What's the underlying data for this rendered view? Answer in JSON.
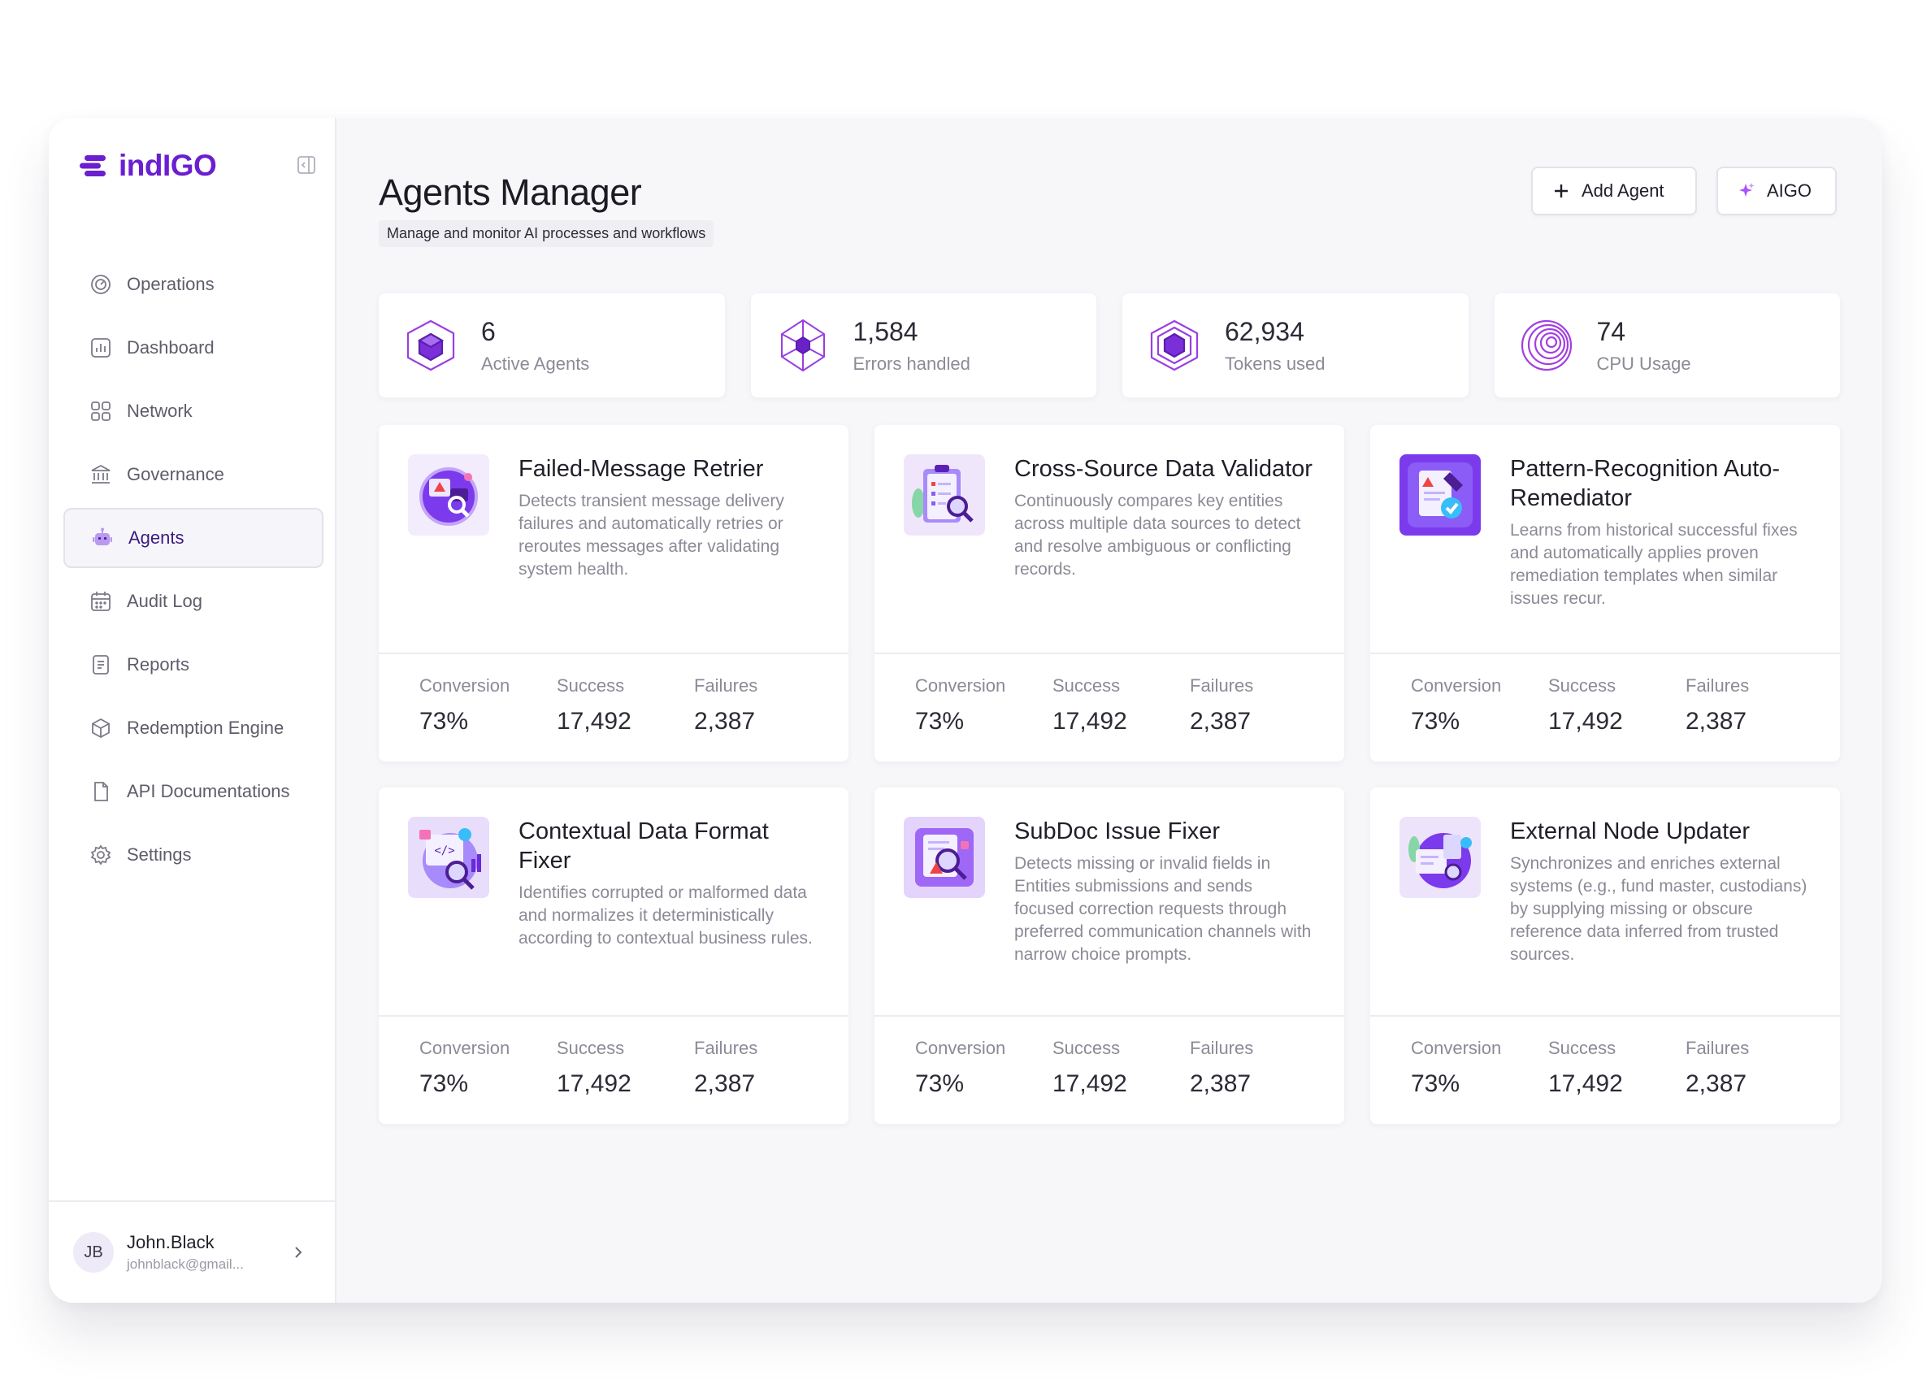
{
  "brand": {
    "name": "indIGO"
  },
  "colors": {
    "accent": "#6b1fd0",
    "accent_light": "#a855f7"
  },
  "sidebar": {
    "items": [
      {
        "label": "Operations",
        "icon": "gauge-icon",
        "active": false
      },
      {
        "label": "Dashboard",
        "icon": "bar-chart-icon",
        "active": false
      },
      {
        "label": "Network",
        "icon": "grid-icon",
        "active": false
      },
      {
        "label": "Governance",
        "icon": "bank-icon",
        "active": false
      },
      {
        "label": "Agents",
        "icon": "robot-icon",
        "active": true
      },
      {
        "label": "Audit Log",
        "icon": "calendar-icon",
        "active": false
      },
      {
        "label": "Reports",
        "icon": "document-list-icon",
        "active": false
      },
      {
        "label": "Redemption Engine",
        "icon": "cube-icon",
        "active": false
      },
      {
        "label": "API Documentations",
        "icon": "file-icon",
        "active": false
      },
      {
        "label": "Settings",
        "icon": "gear-icon",
        "active": false
      }
    ]
  },
  "user": {
    "initials": "JB",
    "name": "John.Black",
    "email": "johnblack@gmail..."
  },
  "header": {
    "title": "Agents Manager",
    "subtitle": "Manage and monitor AI processes and workflows",
    "add_agent_label": "Add Agent",
    "aigo_label": "AIGO"
  },
  "stats": [
    {
      "value": "6",
      "label": "Active Agents",
      "icon": "cube-3d-icon"
    },
    {
      "value": "1,584",
      "label": "Errors handled",
      "icon": "diamond-icon"
    },
    {
      "value": "62,934",
      "label": "Tokens used",
      "icon": "layers-hex-icon"
    },
    {
      "value": "74",
      "label": "CPU Usage",
      "icon": "spiral-icon"
    }
  ],
  "metric_labels": {
    "conversion": "Conversion",
    "success": "Success",
    "failures": "Failures"
  },
  "agents": [
    {
      "title": "Failed-Message Retrier",
      "desc": "Detects transient message delivery failures and automatically retries or reroutes messages after validating system health.",
      "conversion": "73%",
      "success": "17,492",
      "failures": "2,387",
      "icon": "retry-globe-icon"
    },
    {
      "title": "Cross-Source Data Validator",
      "desc": "Continuously compares key entities across multiple data sources to detect and resolve ambiguous or conflicting records.",
      "conversion": "73%",
      "success": "17,492",
      "failures": "2,387",
      "icon": "clipboard-check-icon"
    },
    {
      "title": "Pattern-Recognition Auto-Remediator",
      "desc": "Learns from historical successful fixes and automatically applies proven remediation templates when similar issues recur.",
      "conversion": "73%",
      "success": "17,492",
      "failures": "2,387",
      "icon": "wrench-shield-icon"
    },
    {
      "title": "Contextual Data Format Fixer",
      "desc": "Identifies corrupted or malformed data and normalizes it deterministically according to contextual business rules.",
      "conversion": "73%",
      "success": "17,492",
      "failures": "2,387",
      "icon": "code-search-icon"
    },
    {
      "title": "SubDoc Issue Fixer",
      "desc": "Detects missing or invalid fields in Entities submissions and sends focused correction requests through preferred communication channels with narrow choice prompts.",
      "conversion": "73%",
      "success": "17,492",
      "failures": "2,387",
      "icon": "document-warning-icon"
    },
    {
      "title": "External Node Updater",
      "desc": "Synchronizes and enriches external systems (e.g., fund master, custodians) by supplying missing or obscure reference data inferred from trusted sources.",
      "conversion": "73%",
      "success": "17,492",
      "failures": "2,387",
      "icon": "node-sync-icon"
    }
  ]
}
